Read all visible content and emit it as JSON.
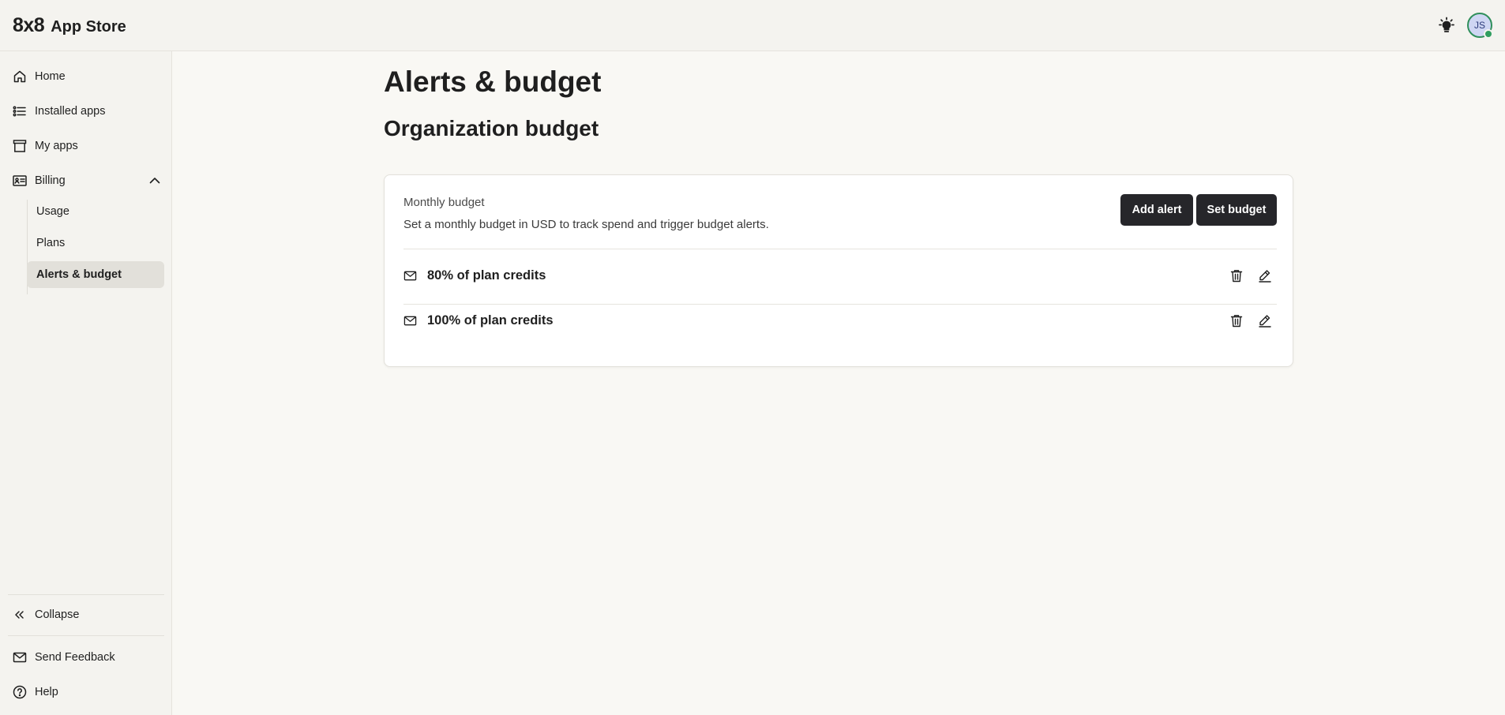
{
  "app": {
    "logo": "8x8",
    "name": "App Store"
  },
  "user": {
    "initials": "JS"
  },
  "sidebar": {
    "items": [
      {
        "label": "Home",
        "icon": "home-icon"
      },
      {
        "label": "Installed apps",
        "icon": "list-icon"
      },
      {
        "label": "My apps",
        "icon": "archive-icon"
      },
      {
        "label": "Billing",
        "icon": "id-card-icon",
        "expanded": true
      }
    ],
    "billing_subitems": [
      {
        "label": "Usage"
      },
      {
        "label": "Plans"
      },
      {
        "label": "Alerts & budget",
        "active": true
      }
    ],
    "footer": {
      "collapse": "Collapse",
      "feedback": "Send Feedback",
      "help": "Help"
    }
  },
  "main": {
    "title": "Alerts & budget",
    "section_title": "Organization budget",
    "card": {
      "label": "Monthly budget",
      "description": "Set a monthly budget in USD to track spend and trigger budget alerts.",
      "add_alert_label": "Add alert",
      "set_budget_label": "Set budget",
      "alerts": [
        {
          "text": "80% of plan credits"
        },
        {
          "text": "100% of plan credits"
        }
      ]
    }
  },
  "colors": {
    "primary_button": "#26262a",
    "active_nav": "#e2e0da",
    "status_online": "#2f9d5f"
  }
}
